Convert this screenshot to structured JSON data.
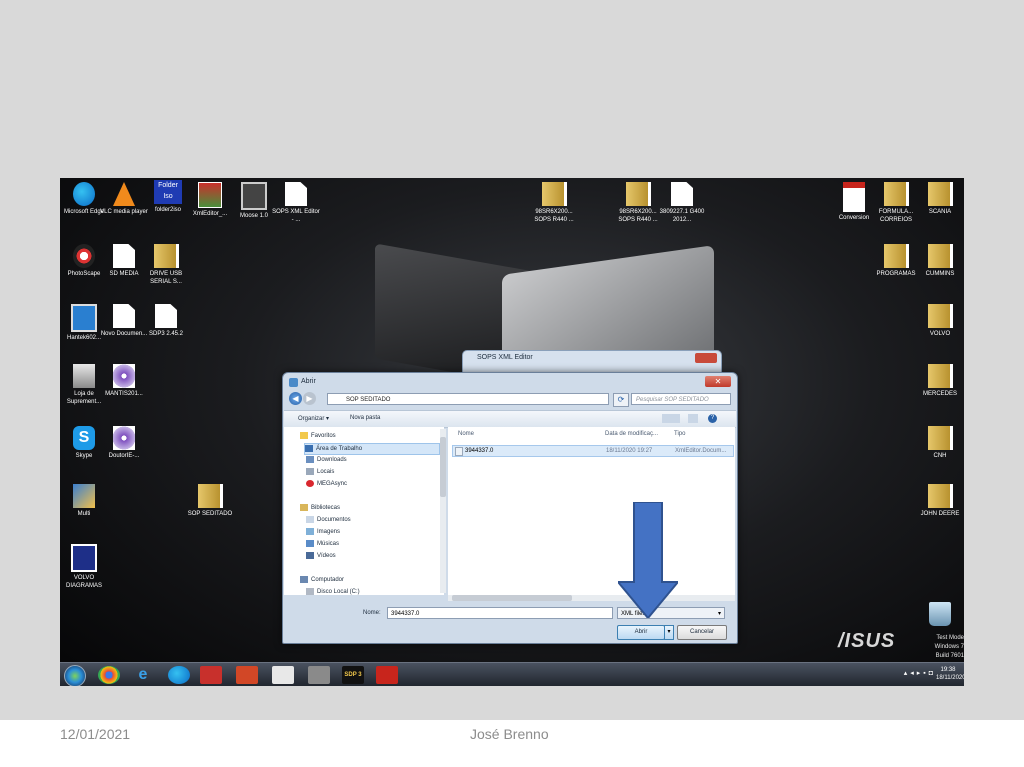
{
  "slide": {
    "date": "12/01/2021",
    "author": "José Brenno"
  },
  "desktop": {
    "icons_left": [
      {
        "label": "Microsoft Edge",
        "icon": "edge-icon"
      },
      {
        "label": "VLC media player",
        "icon": "vlc-icon"
      },
      {
        "label": "folder2iso",
        "icon": "folder2iso-icon",
        "badge": "Folder Iso"
      },
      {
        "label": "XmlEditor_...",
        "icon": "xml-editor-icon"
      },
      {
        "label": "Moose 1.0",
        "icon": "moose-icon"
      },
      {
        "label": "SOPS XML Editor - ...",
        "icon": "sops-icon"
      },
      {
        "label": "PhotoScape",
        "icon": "photoscape-icon"
      },
      {
        "label": "SD MEDIA",
        "icon": "document-icon"
      },
      {
        "label": "DRIVE USB SERIAL S...",
        "icon": "folder-icon"
      },
      {
        "label": "Hantek602...",
        "icon": "monitor-icon"
      },
      {
        "label": "Novo Documen...",
        "icon": "document-icon"
      },
      {
        "label": "SDP3 2.45.2",
        "icon": "document-icon"
      },
      {
        "label": "Loja de Suprement...",
        "icon": "printer-icon"
      },
      {
        "label": "MANTIS201...",
        "icon": "disc-icon"
      },
      {
        "label": "Skype",
        "icon": "skype-icon"
      },
      {
        "label": "DoutorIE-...",
        "icon": "disc-icon"
      },
      {
        "label": "Multi",
        "icon": "multi-icon"
      },
      {
        "label": "SOP SEDITADO",
        "icon": "folder-icon"
      },
      {
        "label": "VOLVO DIAGRAMAS",
        "icon": "volvo-icon"
      }
    ],
    "icons_center": [
      {
        "label": "98SR6X200... SOPS R440 ...",
        "icon": "folder-icon"
      },
      {
        "label": "98SR6X200... SOPS R440 ...",
        "icon": "folder-icon"
      },
      {
        "label": "3809227.1 G400 2012...",
        "icon": "document-icon"
      }
    ],
    "icons_right": [
      {
        "label": "Conversion",
        "icon": "pdf-icon"
      },
      {
        "label": "FORMULA... CORREIOS",
        "icon": "folder-icon"
      },
      {
        "label": "SCANIA",
        "icon": "folder-icon"
      },
      {
        "label": "PROGRAMAS",
        "icon": "folder-icon"
      },
      {
        "label": "CUMMINS",
        "icon": "folder-icon"
      },
      {
        "label": "VOLVO",
        "icon": "folder-icon"
      },
      {
        "label": "MERCEDES",
        "icon": "folder-icon"
      },
      {
        "label": "CNH",
        "icon": "folder-icon"
      },
      {
        "label": "JOHN DEERE",
        "icon": "folder-icon"
      }
    ],
    "recycle_bin_label": "Lixeira",
    "brand": "/ISUS",
    "watermark": {
      "line1": "Test Mode",
      "line2": "Windows 7",
      "line3": "Build 7601"
    }
  },
  "taskbar": {
    "apps": [
      "windows-start-icon",
      "chrome-icon",
      "ie-icon",
      "edge-icon",
      "moose-icon",
      "powerpoint-icon",
      "notepad-icon",
      "disk-icon",
      "sdp3-icon",
      "acrobat-icon"
    ],
    "sdp3_label": "SDP 3",
    "clock_time": "19:38",
    "clock_date": "18/11/2020"
  },
  "back_window": {
    "title": "SOPS XML Editor"
  },
  "dialog": {
    "title": "Abrir",
    "address": "SOP SEDITADO",
    "search_placeholder": "Pesquisar SOP SEDITADO",
    "toolbar": {
      "organize": "Organizar ▾",
      "new_folder": "Nova pasta"
    },
    "nav": {
      "favorites": "Favoritos",
      "items": [
        "Área de Trabalho",
        "Downloads",
        "Locais",
        "MEGAsync"
      ],
      "libraries": "Bibliotecas",
      "lib_items": [
        "Documentos",
        "Imagens",
        "Músicas",
        "Vídeos"
      ],
      "computer": "Computador",
      "drive": "Disco Local (C:)"
    },
    "columns": {
      "name": "Nome",
      "date": "Data de modificaç...",
      "type": "Tipo"
    },
    "files": [
      {
        "name": "3944337.0",
        "date": "18/11/2020 19:27",
        "type": "XmlEditor.Docum..."
      }
    ],
    "filename_label": "Nome:",
    "filename_value": "3944337.0",
    "filetype": "XML files",
    "open_label": "Abrir",
    "cancel_label": "Cancelar"
  },
  "colors": {
    "arrow_fill": "#4472c4",
    "arrow_stroke": "#2f528f"
  }
}
